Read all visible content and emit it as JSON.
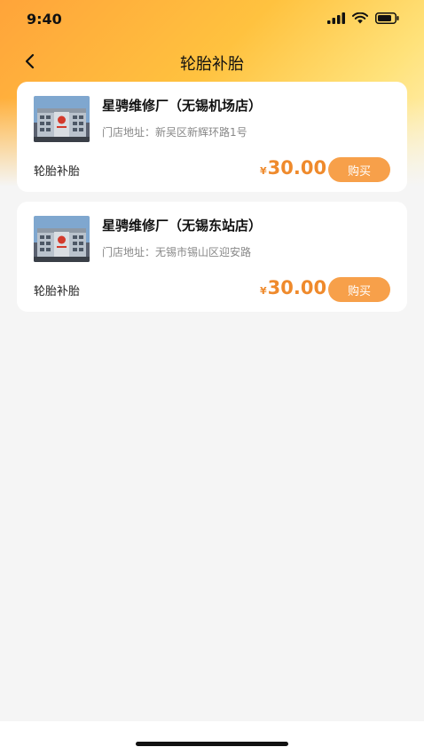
{
  "status_bar": {
    "time": "9:40"
  },
  "nav": {
    "title": "轮胎补胎"
  },
  "stores": [
    {
      "name": "星骋维修厂（无锡机场店）",
      "address_label": "门店地址：",
      "address": "新吴区新辉环路1号",
      "service": "轮胎补胎",
      "currency": "¥",
      "price": "30.00",
      "buy_label": "购买"
    },
    {
      "name": "星骋维修厂（无锡东站店）",
      "address_label": "门店地址：",
      "address": "无锡市锡山区迎安路",
      "service": "轮胎补胎",
      "currency": "¥",
      "price": "30.00",
      "buy_label": "购买"
    }
  ],
  "colors": {
    "accent": "#ef8a2c",
    "button": "#f7a04a",
    "header_gradient_start": "#ffa43a",
    "header_gradient_end": "#fff2c0"
  },
  "icons": [
    "signal-icon",
    "wifi-icon",
    "battery-icon",
    "back-arrow-icon",
    "store-photo"
  ]
}
